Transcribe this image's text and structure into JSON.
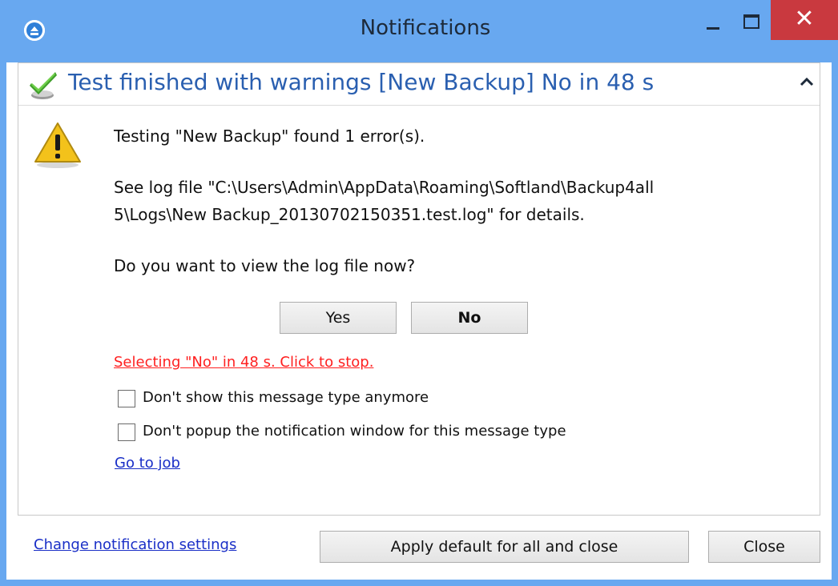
{
  "window": {
    "title": "Notifications",
    "close_glyph": "✕"
  },
  "notification": {
    "title": "Test finished with warnings [New Backup] No in 48 s",
    "message_line1": "Testing \"New Backup\" found 1 error(s).",
    "message_line2": "See log file \"C:\\Users\\Admin\\AppData\\Roaming\\Softland\\Backup4all",
    "message_line3": "5\\Logs\\New Backup_20130702150351.test.log\" for details.",
    "question": "Do you want to view the log file now?",
    "yes_label": "Yes",
    "no_label": "No",
    "countdown_link": "Selecting \"No\" in 48 s. Click to stop.",
    "option1_label": "Don't show this message type anymore",
    "option1_checked": false,
    "option2_label": "Don't popup the notification window for this message type",
    "option2_checked": false,
    "go_to_job_link": "Go to job"
  },
  "footer": {
    "settings_link": "Change notification settings",
    "apply_default_label": "Apply default for all and close",
    "close_label": "Close"
  },
  "icons": {
    "app": "backup4all-app-icon",
    "status": "checkmark-success-icon",
    "collapse": "chevron-up-icon",
    "warning": "warning-triangle-icon"
  },
  "colors": {
    "titlebar": "#68a8f0",
    "close_button": "#c9393f",
    "header_title": "#2a5fb0",
    "countdown_link": "#ff2020",
    "link": "#1a2fc7"
  }
}
